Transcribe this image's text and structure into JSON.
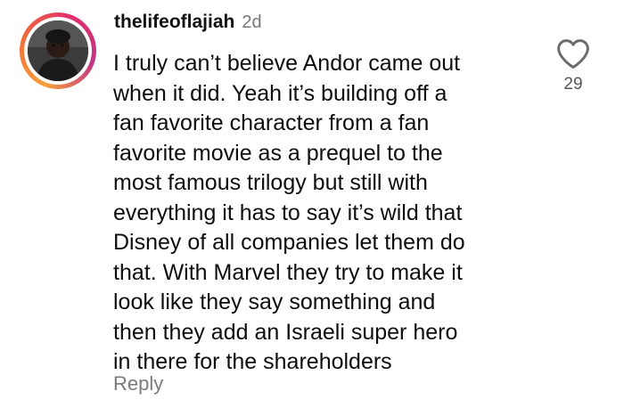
{
  "comment": {
    "username": "thelifeoflajiah",
    "time": "2d",
    "lines": [
      "I truly can’t believe Andor came out",
      "when it did. Yeah it’s building off a",
      "fan favorite character from a fan",
      "favorite movie as a prequel to the",
      "most famous trilogy but still with",
      "everything it has to say it’s wild that",
      "Disney of all companies let them do",
      "that. With Marvel they try to make it",
      "look like they say something and",
      "then they add an Israeli super hero",
      "in there for the shareholders"
    ],
    "reply_label": "Reply",
    "like_count": "29",
    "like_icon": "heart-outline-icon",
    "story_ring_colors": [
      "#f9a13b",
      "#f26b3a",
      "#e1306c",
      "#c13584"
    ]
  }
}
